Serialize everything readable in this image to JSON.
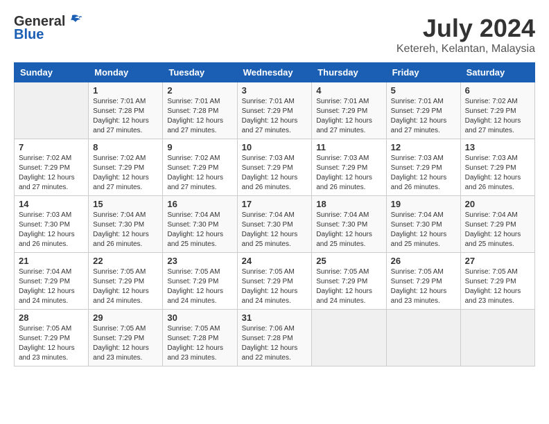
{
  "header": {
    "logo_general": "General",
    "logo_blue": "Blue",
    "month_title": "July 2024",
    "location": "Ketereh, Kelantan, Malaysia"
  },
  "weekdays": [
    "Sunday",
    "Monday",
    "Tuesday",
    "Wednesday",
    "Thursday",
    "Friday",
    "Saturday"
  ],
  "weeks": [
    [
      {
        "day": "",
        "info": ""
      },
      {
        "day": "1",
        "info": "Sunrise: 7:01 AM\nSunset: 7:28 PM\nDaylight: 12 hours\nand 27 minutes."
      },
      {
        "day": "2",
        "info": "Sunrise: 7:01 AM\nSunset: 7:28 PM\nDaylight: 12 hours\nand 27 minutes."
      },
      {
        "day": "3",
        "info": "Sunrise: 7:01 AM\nSunset: 7:29 PM\nDaylight: 12 hours\nand 27 minutes."
      },
      {
        "day": "4",
        "info": "Sunrise: 7:01 AM\nSunset: 7:29 PM\nDaylight: 12 hours\nand 27 minutes."
      },
      {
        "day": "5",
        "info": "Sunrise: 7:01 AM\nSunset: 7:29 PM\nDaylight: 12 hours\nand 27 minutes."
      },
      {
        "day": "6",
        "info": "Sunrise: 7:02 AM\nSunset: 7:29 PM\nDaylight: 12 hours\nand 27 minutes."
      }
    ],
    [
      {
        "day": "7",
        "info": "Sunrise: 7:02 AM\nSunset: 7:29 PM\nDaylight: 12 hours\nand 27 minutes."
      },
      {
        "day": "8",
        "info": "Sunrise: 7:02 AM\nSunset: 7:29 PM\nDaylight: 12 hours\nand 27 minutes."
      },
      {
        "day": "9",
        "info": "Sunrise: 7:02 AM\nSunset: 7:29 PM\nDaylight: 12 hours\nand 27 minutes."
      },
      {
        "day": "10",
        "info": "Sunrise: 7:03 AM\nSunset: 7:29 PM\nDaylight: 12 hours\nand 26 minutes."
      },
      {
        "day": "11",
        "info": "Sunrise: 7:03 AM\nSunset: 7:29 PM\nDaylight: 12 hours\nand 26 minutes."
      },
      {
        "day": "12",
        "info": "Sunrise: 7:03 AM\nSunset: 7:29 PM\nDaylight: 12 hours\nand 26 minutes."
      },
      {
        "day": "13",
        "info": "Sunrise: 7:03 AM\nSunset: 7:29 PM\nDaylight: 12 hours\nand 26 minutes."
      }
    ],
    [
      {
        "day": "14",
        "info": "Sunrise: 7:03 AM\nSunset: 7:30 PM\nDaylight: 12 hours\nand 26 minutes."
      },
      {
        "day": "15",
        "info": "Sunrise: 7:04 AM\nSunset: 7:30 PM\nDaylight: 12 hours\nand 26 minutes."
      },
      {
        "day": "16",
        "info": "Sunrise: 7:04 AM\nSunset: 7:30 PM\nDaylight: 12 hours\nand 25 minutes."
      },
      {
        "day": "17",
        "info": "Sunrise: 7:04 AM\nSunset: 7:30 PM\nDaylight: 12 hours\nand 25 minutes."
      },
      {
        "day": "18",
        "info": "Sunrise: 7:04 AM\nSunset: 7:30 PM\nDaylight: 12 hours\nand 25 minutes."
      },
      {
        "day": "19",
        "info": "Sunrise: 7:04 AM\nSunset: 7:30 PM\nDaylight: 12 hours\nand 25 minutes."
      },
      {
        "day": "20",
        "info": "Sunrise: 7:04 AM\nSunset: 7:29 PM\nDaylight: 12 hours\nand 25 minutes."
      }
    ],
    [
      {
        "day": "21",
        "info": "Sunrise: 7:04 AM\nSunset: 7:29 PM\nDaylight: 12 hours\nand 24 minutes."
      },
      {
        "day": "22",
        "info": "Sunrise: 7:05 AM\nSunset: 7:29 PM\nDaylight: 12 hours\nand 24 minutes."
      },
      {
        "day": "23",
        "info": "Sunrise: 7:05 AM\nSunset: 7:29 PM\nDaylight: 12 hours\nand 24 minutes."
      },
      {
        "day": "24",
        "info": "Sunrise: 7:05 AM\nSunset: 7:29 PM\nDaylight: 12 hours\nand 24 minutes."
      },
      {
        "day": "25",
        "info": "Sunrise: 7:05 AM\nSunset: 7:29 PM\nDaylight: 12 hours\nand 24 minutes."
      },
      {
        "day": "26",
        "info": "Sunrise: 7:05 AM\nSunset: 7:29 PM\nDaylight: 12 hours\nand 23 minutes."
      },
      {
        "day": "27",
        "info": "Sunrise: 7:05 AM\nSunset: 7:29 PM\nDaylight: 12 hours\nand 23 minutes."
      }
    ],
    [
      {
        "day": "28",
        "info": "Sunrise: 7:05 AM\nSunset: 7:29 PM\nDaylight: 12 hours\nand 23 minutes."
      },
      {
        "day": "29",
        "info": "Sunrise: 7:05 AM\nSunset: 7:29 PM\nDaylight: 12 hours\nand 23 minutes."
      },
      {
        "day": "30",
        "info": "Sunrise: 7:05 AM\nSunset: 7:28 PM\nDaylight: 12 hours\nand 23 minutes."
      },
      {
        "day": "31",
        "info": "Sunrise: 7:06 AM\nSunset: 7:28 PM\nDaylight: 12 hours\nand 22 minutes."
      },
      {
        "day": "",
        "info": ""
      },
      {
        "day": "",
        "info": ""
      },
      {
        "day": "",
        "info": ""
      }
    ]
  ]
}
